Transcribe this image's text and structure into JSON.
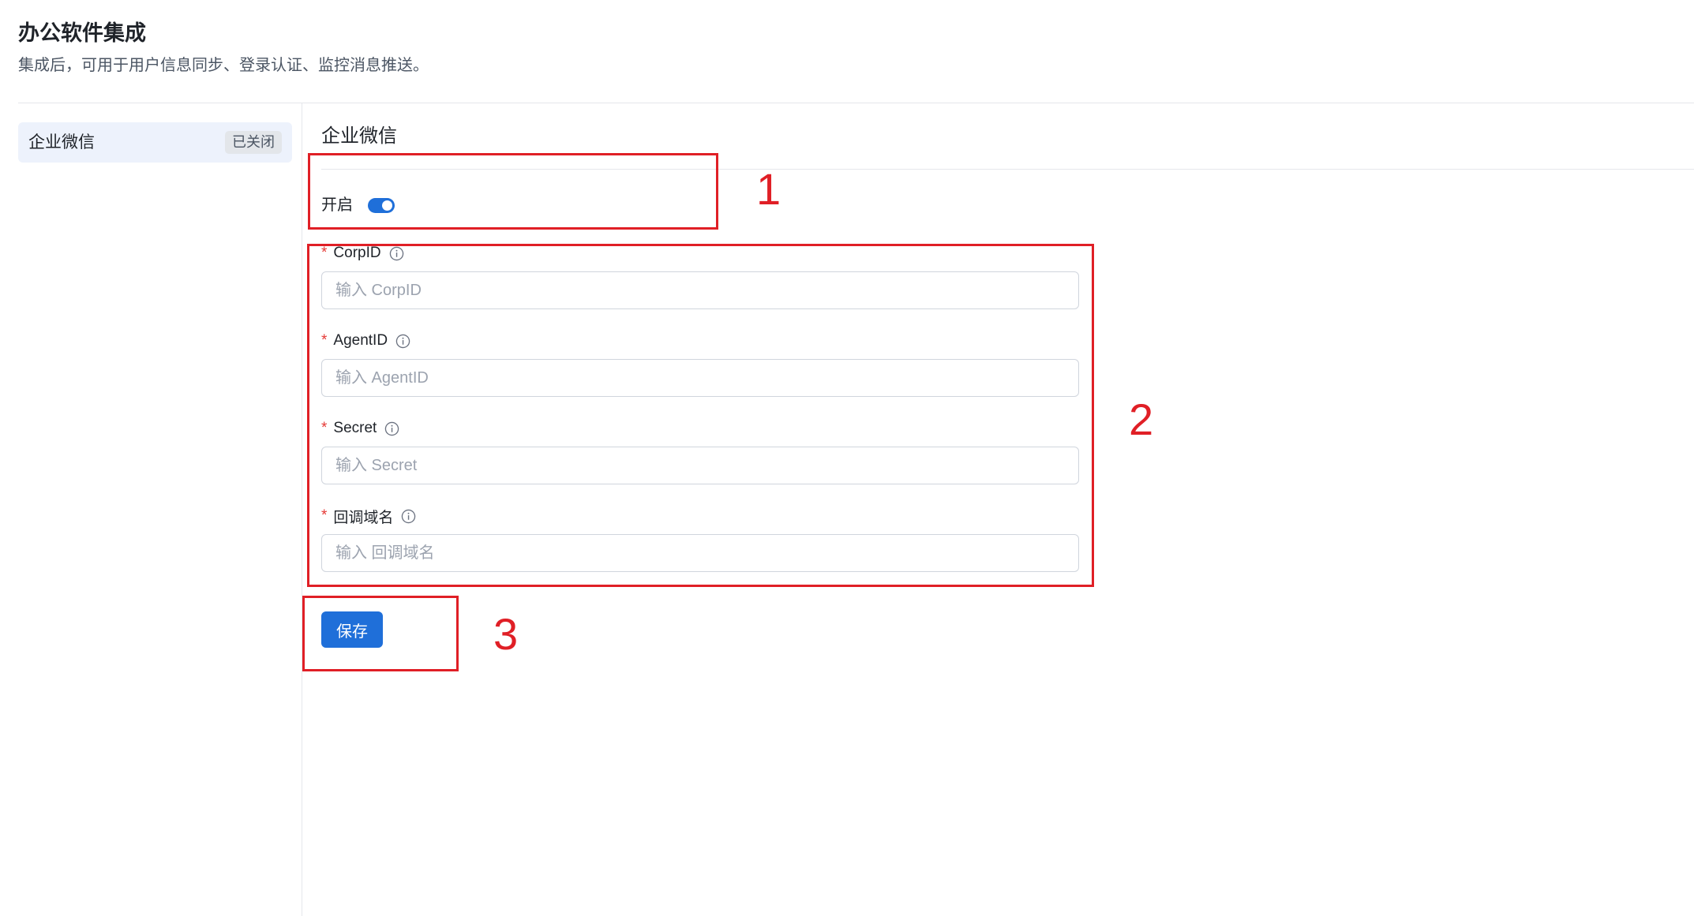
{
  "header": {
    "title": "办公软件集成",
    "description": "集成后，可用于用户信息同步、登录认证、监控消息推送。"
  },
  "sidebar": {
    "items": [
      {
        "label": "企业微信",
        "status": "已关闭"
      }
    ]
  },
  "main": {
    "section_title": "企业微信",
    "enable": {
      "label": "开启",
      "on": true
    },
    "fields": [
      {
        "label": "CorpID",
        "required": true,
        "placeholder": "输入 CorpID",
        "value": ""
      },
      {
        "label": "AgentID",
        "required": true,
        "placeholder": "输入 AgentID",
        "value": ""
      },
      {
        "label": "Secret",
        "required": true,
        "placeholder": "输入 Secret",
        "value": ""
      },
      {
        "label": "回调域名",
        "required": true,
        "placeholder": "输入 回调域名",
        "value": ""
      }
    ],
    "required_mark": "*",
    "save_label": "保存"
  },
  "annotations": [
    "1",
    "2",
    "3"
  ],
  "colors": {
    "primary": "#1f6fd9",
    "annotation": "#e01f26",
    "required": "#e53935",
    "sidebar_active_bg": "#edf2fc"
  },
  "icons": {
    "info": "info-circle-icon"
  }
}
